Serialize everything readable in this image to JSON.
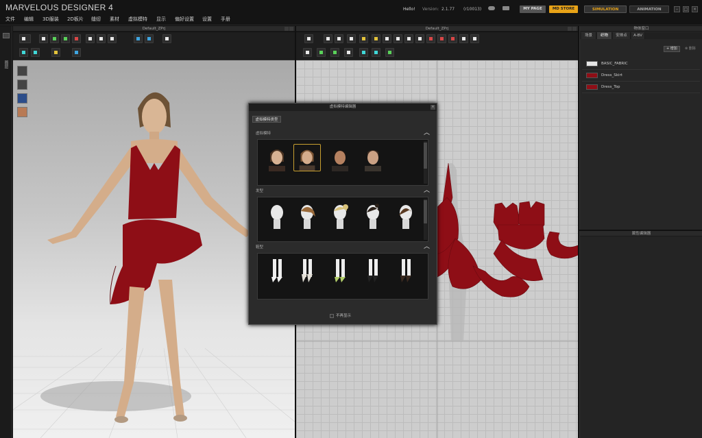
{
  "app": {
    "title": "MARVELOUS DESIGNER 4"
  },
  "top": {
    "hello": "Hello!",
    "version_label": "Version:",
    "version": "2.1.77",
    "build": "(r10013)",
    "mypage": "MY PAGE",
    "mdstore": "MD STORE",
    "simulation": "SIMULATION",
    "animation": "ANIMATION"
  },
  "menu": [
    "文件",
    "编辑",
    "3D服装",
    "2D板片",
    "缝纫",
    "素材",
    "虚拟模特",
    "显示",
    "偏好设置",
    "设置",
    "手册"
  ],
  "left_strip": {
    "label": "图层"
  },
  "panel3d": {
    "title": "Default_ZPrj"
  },
  "panel2d": {
    "title": "Default_ZPrj"
  },
  "object_panel": {
    "title": "物体窗口",
    "tabs": [
      "场景",
      "织物",
      "安排点",
      "A-BV"
    ],
    "active_tab": 1,
    "add_label": "增加",
    "delete_label": "删除",
    "fabrics": [
      {
        "name": "BASIC_FABRIC",
        "color": "#e6e6e6"
      },
      {
        "name": "Dress_Skirt",
        "color": "#8e0e16"
      },
      {
        "name": "Dress_Top",
        "color": "#8e0e16"
      }
    ]
  },
  "property_panel": {
    "title": "属性编辑器"
  },
  "avatar_dialog": {
    "title": "虚拟模特编辑器",
    "tab": "虚拟模特类型",
    "sections": [
      {
        "title": "虚拟模特"
      },
      {
        "title": "发型"
      },
      {
        "title": "鞋型"
      }
    ],
    "dont_show": "不再显示"
  },
  "colors": {
    "accent_orange": "#e8a317",
    "fabric_red": "#8e0e16",
    "panel_bg": "#262626"
  }
}
